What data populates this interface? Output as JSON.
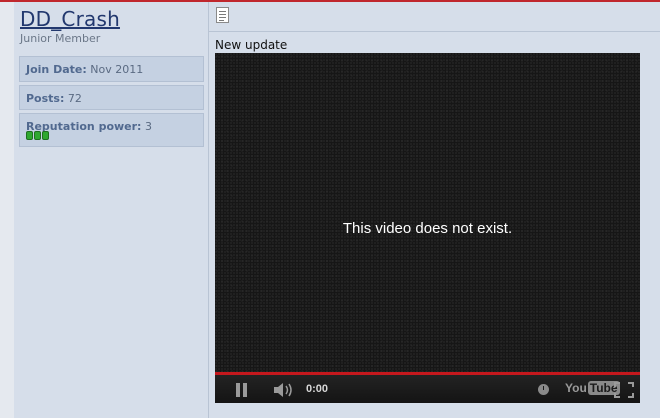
{
  "user": {
    "username": "DD_Crash",
    "title": "Junior Member",
    "join_date_label": "Join Date:",
    "join_date_value": "Nov 2011",
    "posts_label": "Posts:",
    "posts_value": "72",
    "reputation_label": "Reputation power:",
    "reputation_value": "3",
    "reputation_pips": 3
  },
  "post": {
    "icon": "document-icon",
    "text": "New update"
  },
  "video": {
    "message": "This video does not exist.",
    "time": "0:00",
    "logo_you": "You",
    "logo_tube": "Tube",
    "progress_color": "#c4181d"
  },
  "colors": {
    "accent_top_border": "#c0272d",
    "username": "#22386e",
    "panel": "#d6deea"
  }
}
